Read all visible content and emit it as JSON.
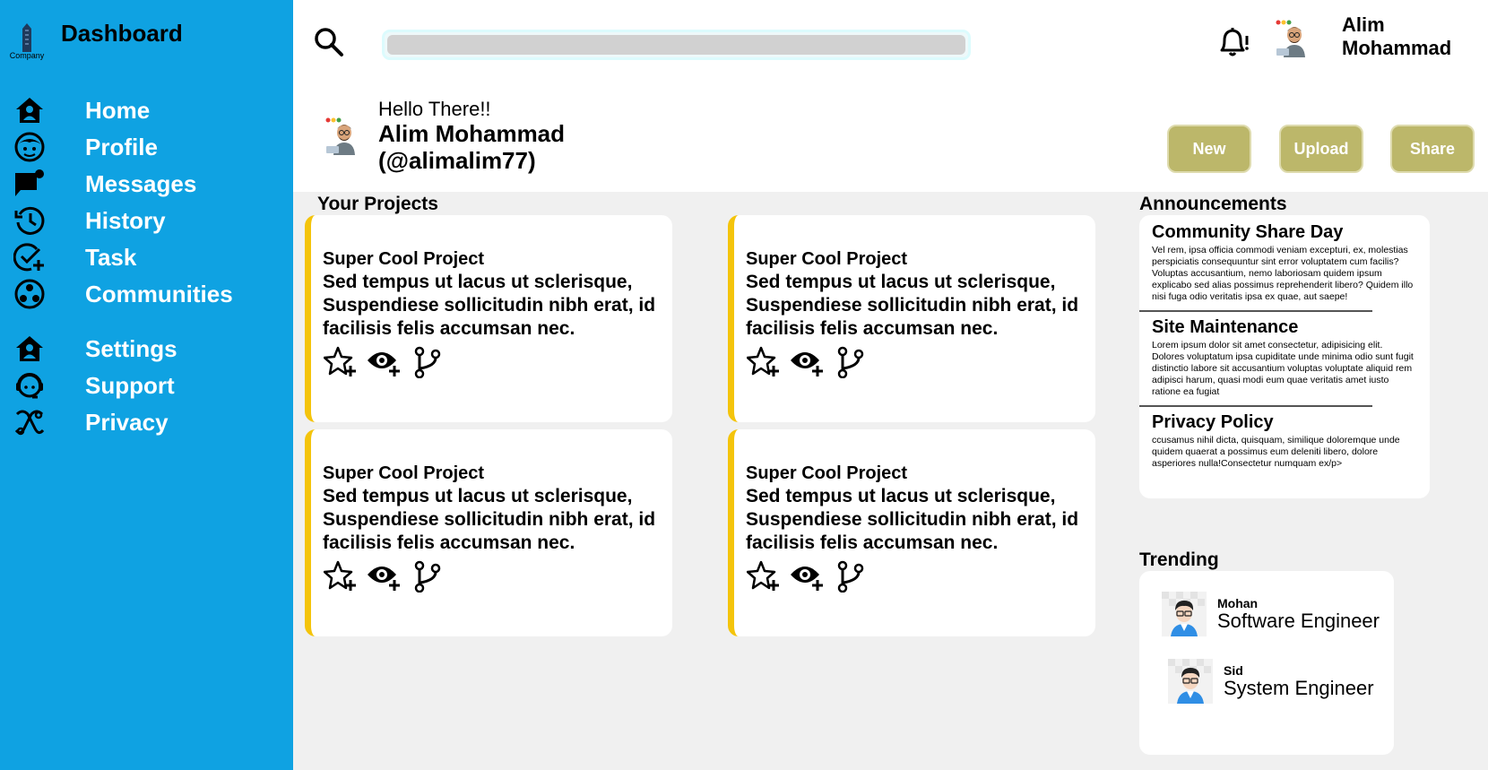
{
  "sidebar": {
    "brand": "Company",
    "title": "Dashboard",
    "items": [
      {
        "label": "Home",
        "icon": "home-icon"
      },
      {
        "label": "Profile",
        "icon": "profile-icon"
      },
      {
        "label": "Messages",
        "icon": "messages-icon"
      },
      {
        "label": "History",
        "icon": "history-icon"
      },
      {
        "label": "Task",
        "icon": "task-icon"
      },
      {
        "label": "Communities",
        "icon": "communities-icon"
      },
      {
        "label": "Settings",
        "icon": "settings-icon"
      },
      {
        "label": "Support",
        "icon": "support-icon"
      },
      {
        "label": "Privacy",
        "icon": "privacy-icon"
      }
    ]
  },
  "header": {
    "search_placeholder": "",
    "user_name": "Alim Mohammad",
    "greeting": "Hello There!!",
    "profile_name": "Alim Mohammad (@alimalim77)",
    "buttons": {
      "new": "New",
      "upload": "Upload",
      "share": "Share"
    }
  },
  "projects": {
    "title": "Your Projects",
    "cards": [
      {
        "title": "Super Cool Project",
        "description": "Sed tempus ut lacus ut sclerisque, Suspendiese sollicitudin nibh erat, id facilisis felis accumsan nec."
      },
      {
        "title": "Super Cool Project",
        "description": "Sed tempus ut lacus ut sclerisque, Suspendiese sollicitudin nibh erat, id facilisis felis accumsan nec."
      },
      {
        "title": "Super Cool Project",
        "description": "Sed tempus ut lacus ut sclerisque, Suspendiese sollicitudin nibh erat, id facilisis felis accumsan nec."
      },
      {
        "title": "Super Cool Project",
        "description": "Sed tempus ut lacus ut sclerisque, Suspendiese sollicitudin nibh erat, id facilisis felis accumsan nec."
      }
    ]
  },
  "announcements": {
    "title": "Announcements",
    "items": [
      {
        "title": "Community Share Day",
        "body": "Vel rem, ipsa officia commodi veniam excepturi, ex, molestias perspiciatis consequuntur sint error voluptatem cum facilis? Voluptas accusantium, nemo laboriosam quidem ipsum explicabo sed alias possimus reprehenderit libero? Quidem illo nisi fuga odio veritatis ipsa ex quae, aut saepe!"
      },
      {
        "title": "Site Maintenance",
        "body": "Lorem ipsum dolor sit amet consectetur, adipisicing elit. Dolores voluptatum ipsa cupiditate unde minima odio sunt fugit distinctio labore sit accusantium voluptas voluptate aliquid rem adipisci harum, quasi modi eum quae veritatis amet iusto ratione ea fugiat"
      },
      {
        "title": "Privacy Policy",
        "body": "ccusamus nihil dicta, quisquam, similique doloremque unde quidem quaerat a possimus eum deleniti libero, dolore asperiores nulla!Consectetur numquam ex/p>"
      }
    ]
  },
  "trending": {
    "title": "Trending",
    "items": [
      {
        "name": "Mohan",
        "role": "Software Engineer"
      },
      {
        "name": "Sid",
        "role": "System Engineer"
      }
    ]
  },
  "colors": {
    "sidebar": "#0fa2e2",
    "accent_button": "#bcb76a",
    "card_border": "#f4c40b",
    "page_bg": "#f0f0f0"
  }
}
